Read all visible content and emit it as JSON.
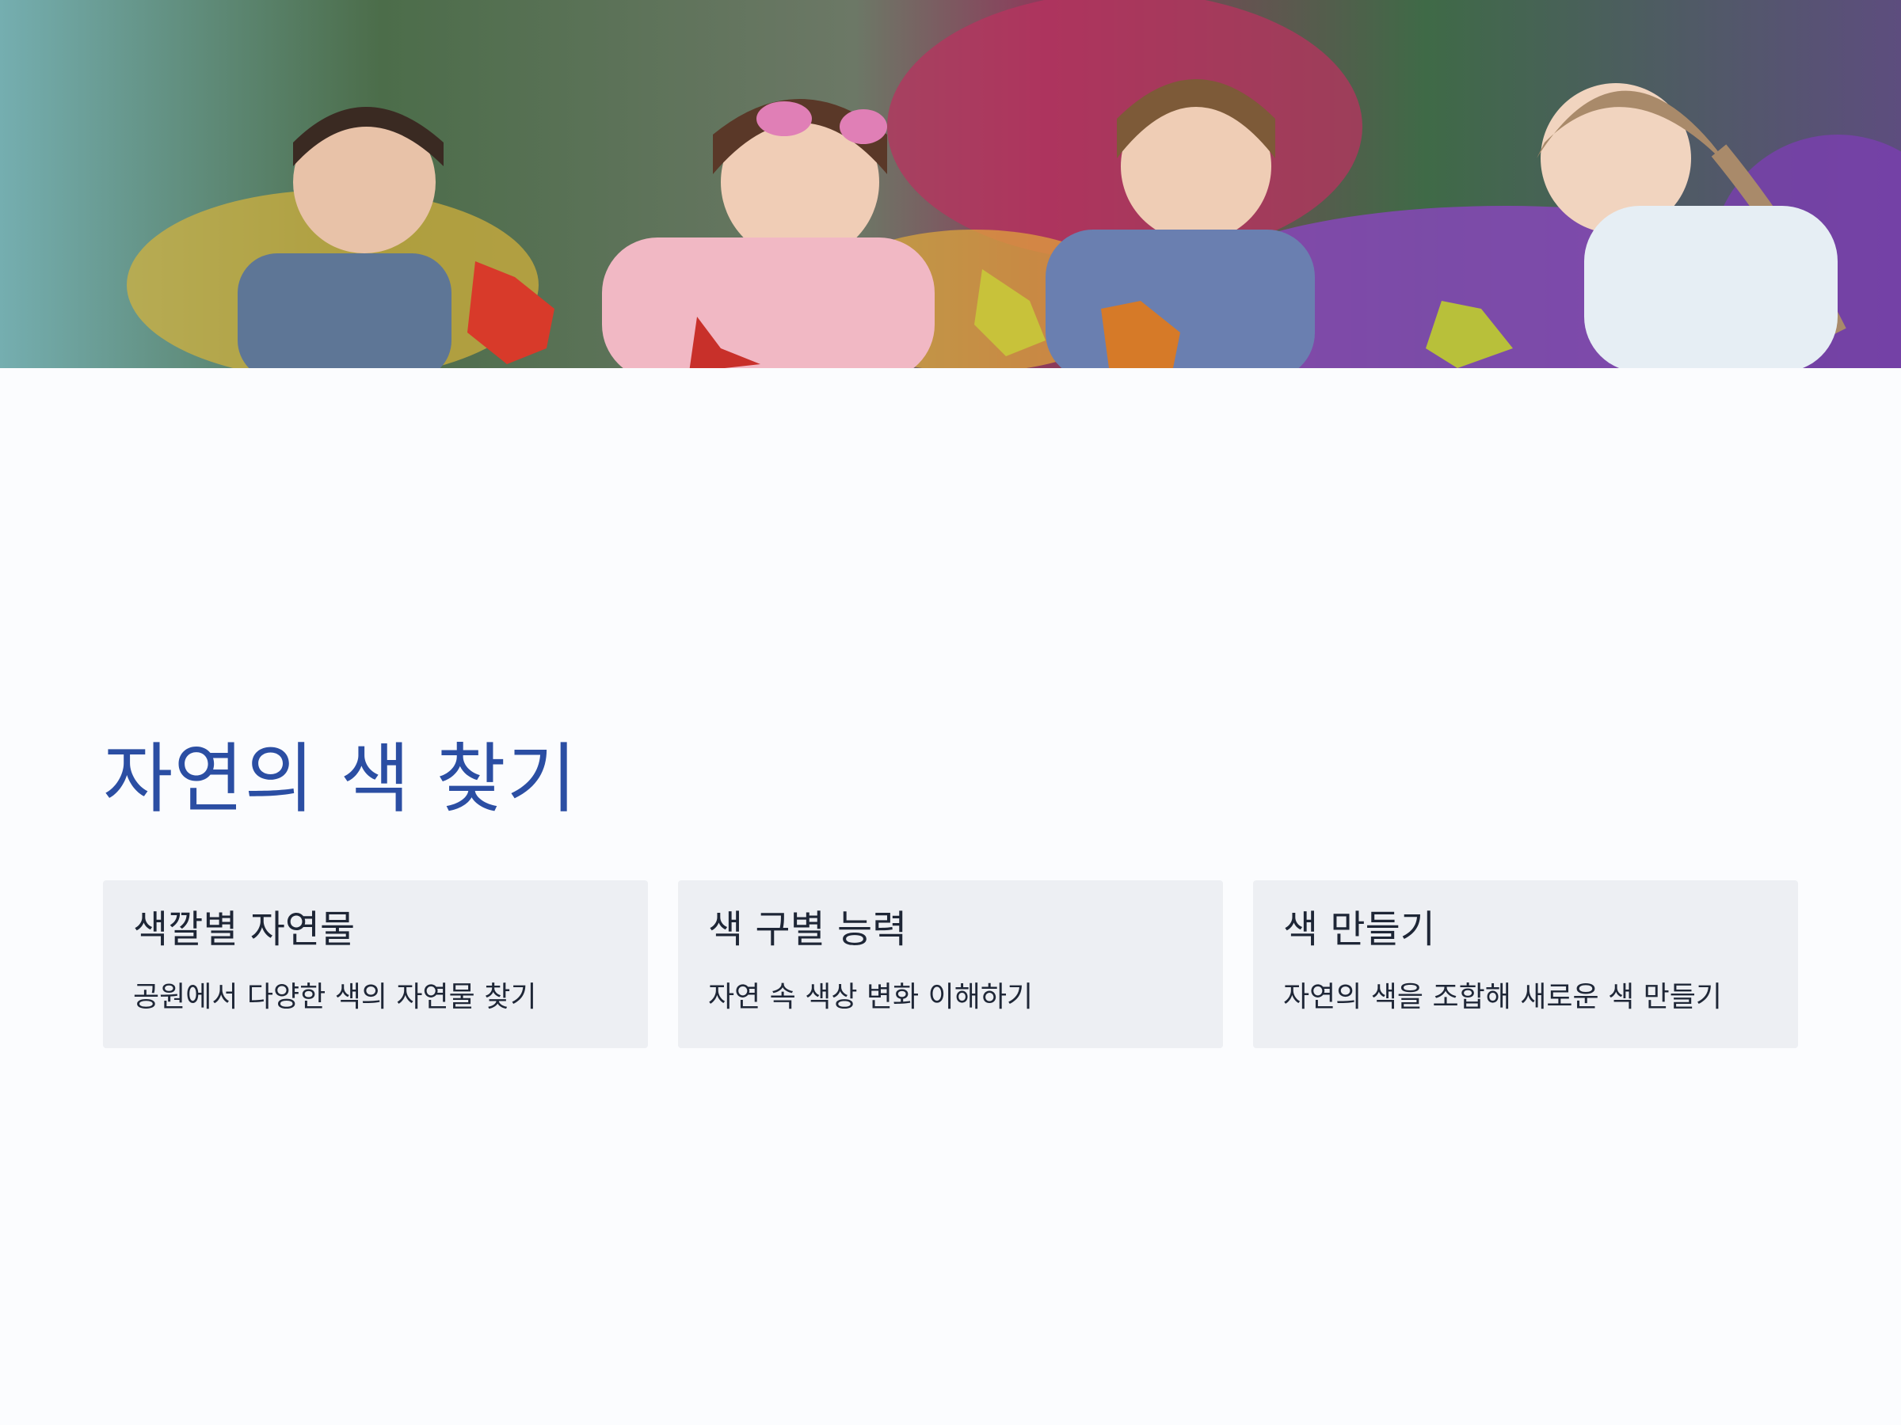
{
  "hero": {
    "image": "children-collecting-autumn-leaves-in-flower-garden"
  },
  "title": "자연의 색 찾기",
  "cards": [
    {
      "title": "색깔별 자연물",
      "description": "공원에서 다양한 색의 자연물 찾기"
    },
    {
      "title": "색 구별 능력",
      "description": "자연 속 색상 변화 이해하기"
    },
    {
      "title": "색 만들기",
      "description": "자연의 색을 조합해 새로운 색 만들기"
    }
  ],
  "colors": {
    "title": "#2b4ea3",
    "card_bg": "#edeff3",
    "page_bg": "#fbfcfe"
  }
}
